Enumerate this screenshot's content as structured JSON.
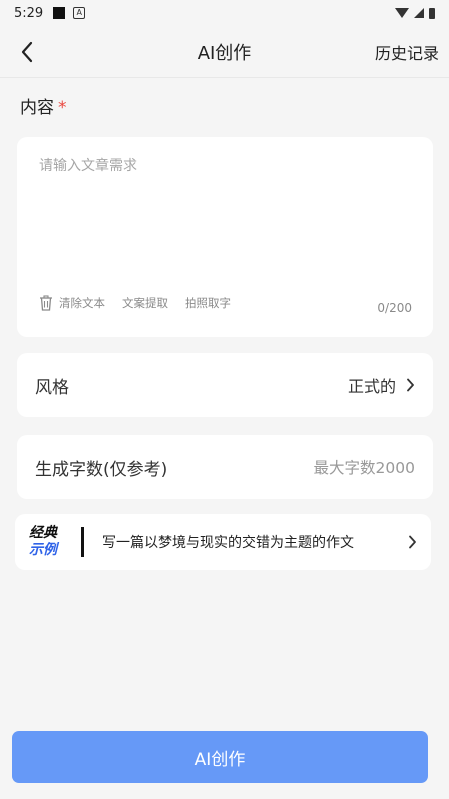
{
  "status_bar": {
    "time": "5:29",
    "notification_icon": "A"
  },
  "nav": {
    "title": "AI创作",
    "history": "历史记录"
  },
  "content": {
    "label": "内容",
    "required_mark": "*",
    "placeholder": "请输入文章需求",
    "value": "",
    "tools": {
      "clear": "清除文本",
      "extract": "文案提取",
      "photo": "拍照取字"
    },
    "counter": "0/200"
  },
  "style_row": {
    "label": "风格",
    "value": "正式的"
  },
  "wordcount_row": {
    "label": "生成字数(仅参考)",
    "placeholder": "最大字数2000"
  },
  "example": {
    "badge_line1": "经典",
    "badge_line2": "示例",
    "text": "写一篇以梦境与现实的交错为主题的作文"
  },
  "submit": {
    "label": "AI创作"
  },
  "colors": {
    "accent": "#6699f7",
    "required": "#e9473f",
    "badge_blue": "#2f63e8",
    "background": "#f5f5f5"
  }
}
